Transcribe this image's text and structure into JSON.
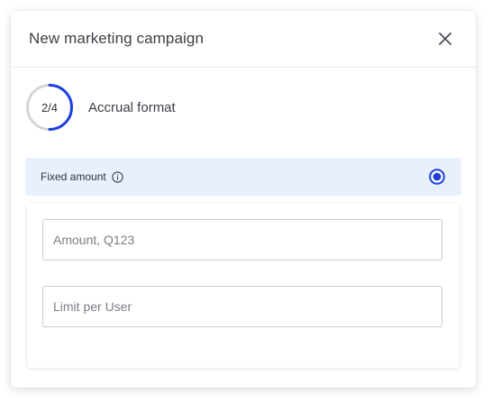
{
  "dialog": {
    "title": "New marketing campaign",
    "close_icon": "close-icon"
  },
  "step": {
    "counter": "2/4",
    "current": 2,
    "total": 4,
    "label": "Accrual format",
    "ring_color": "#1c3fe0",
    "track_color": "#d3d5d9"
  },
  "option": {
    "label": "Fixed amount",
    "info_icon": "info-icon",
    "selected": true,
    "accent_color": "#1c3fe0",
    "background_color": "#e9f0fd"
  },
  "fields": {
    "amount": {
      "placeholder": "Amount, Q123",
      "value": ""
    },
    "limit": {
      "placeholder": "Limit per User",
      "value": ""
    }
  }
}
